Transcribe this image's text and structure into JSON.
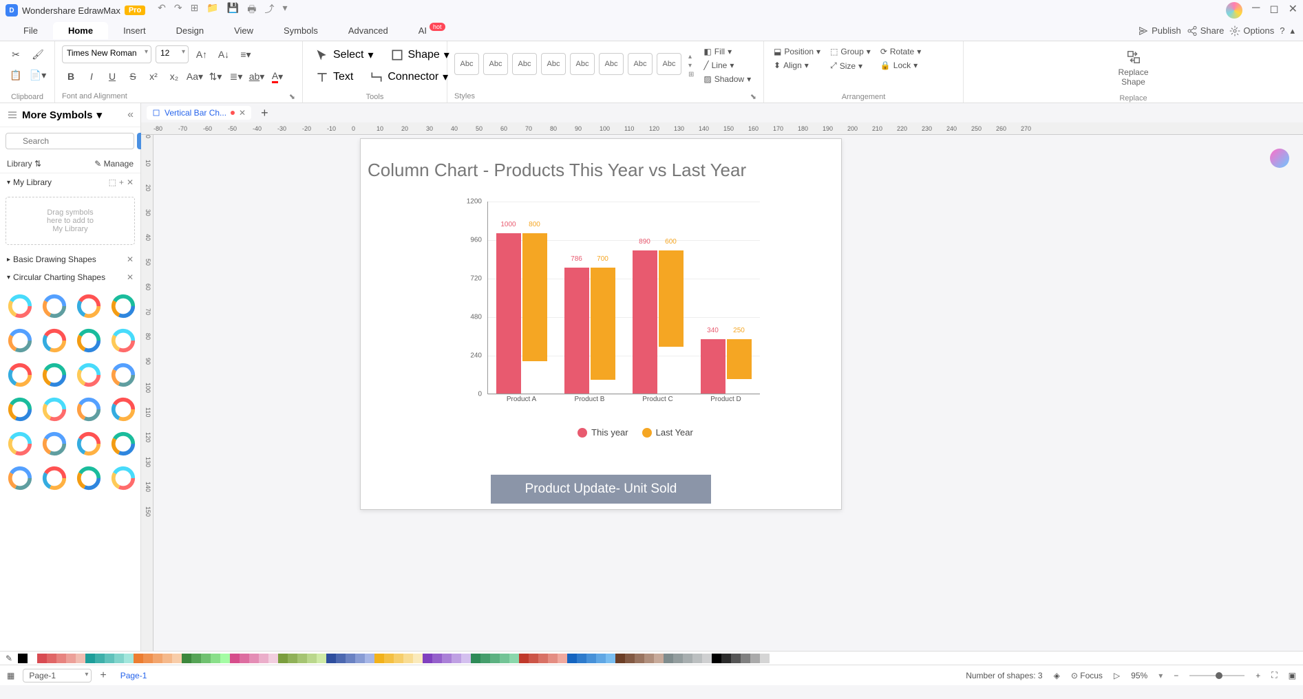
{
  "titlebar": {
    "app_name": "Wondershare EdrawMax",
    "pro": "Pro"
  },
  "menus": [
    "File",
    "Home",
    "Insert",
    "Design",
    "View",
    "Symbols",
    "Advanced",
    "AI"
  ],
  "menu_active": "Home",
  "menu_hot": "hot",
  "menu_right": {
    "publish": "Publish",
    "share": "Share",
    "options": "Options"
  },
  "ribbon": {
    "clipboard_label": "Clipboard",
    "font_label": "Font and Alignment",
    "tools_label": "Tools",
    "styles_label": "Styles",
    "arrangement_label": "Arrangement",
    "replace_label": "Replace",
    "font_family": "Times New Roman",
    "font_size": "12",
    "select": "Select",
    "shape": "Shape",
    "text": "Text",
    "connector": "Connector",
    "style_sample": "Abc",
    "fill": "Fill",
    "line": "Line",
    "shadow": "Shadow",
    "position": "Position",
    "group": "Group",
    "rotate": "Rotate",
    "align": "Align",
    "size": "Size",
    "lock": "Lock",
    "replace_shape": "Replace\nShape"
  },
  "left": {
    "more_symbols": "More Symbols",
    "search_placeholder": "Search",
    "search_btn": "Search",
    "library": "Library",
    "manage": "Manage",
    "section_my_library": "My Library",
    "drop_hint": "Drag symbols\nhere to add to\nMy Library",
    "section_basic": "Basic Drawing Shapes",
    "section_circular": "Circular Charting Shapes"
  },
  "doc_tab": "Vertical Bar Ch...",
  "ruler_h": [
    "-80",
    "-70",
    "-60",
    "-50",
    "-40",
    "-30",
    "-20",
    "-10",
    "0",
    "10",
    "20",
    "30",
    "40",
    "50",
    "60",
    "70",
    "80",
    "90",
    "100",
    "110",
    "120",
    "130",
    "140",
    "150",
    "160",
    "170",
    "180",
    "190",
    "200",
    "210",
    "220",
    "230",
    "240",
    "250",
    "260",
    "270"
  ],
  "ruler_v": [
    "0",
    "10",
    "20",
    "30",
    "40",
    "50",
    "60",
    "70",
    "80",
    "90",
    "100",
    "110",
    "120",
    "130",
    "140",
    "150"
  ],
  "chart_data": {
    "type": "bar",
    "title": "Column Chart - Products This Year vs Last Year",
    "categories": [
      "Product A",
      "Product B",
      "Product C",
      "Product D"
    ],
    "series": [
      {
        "name": "This year",
        "values": [
          1000,
          786,
          890,
          340
        ],
        "color": "#e85a6f"
      },
      {
        "name": "Last Year",
        "values": [
          800,
          700,
          600,
          250
        ],
        "color": "#f5a623"
      }
    ],
    "y_ticks": [
      0,
      240,
      480,
      720,
      960,
      1200
    ],
    "ylim": [
      0,
      1200
    ],
    "caption": "Product Update- Unit Sold"
  },
  "colors": [
    "#000000",
    "#ffffff",
    "#d84b52",
    "#e06666",
    "#e7837f",
    "#eca099",
    "#f1bdb2",
    "#1e9e9a",
    "#3fb0aa",
    "#60c2bb",
    "#81d4cb",
    "#a2e6dc",
    "#ec7d31",
    "#ef914f",
    "#f2a56d",
    "#f5b98b",
    "#f8cda9",
    "#3c873c",
    "#56a456",
    "#70c170",
    "#8adf8a",
    "#a4fca4",
    "#d64d8b",
    "#dd6da0",
    "#e48db5",
    "#ebaeca",
    "#f2cedf",
    "#7b9e3e",
    "#90b158",
    "#a5c472",
    "#bad78c",
    "#cfeaa6",
    "#2e4e9e",
    "#4c68b0",
    "#6a82c2",
    "#889cd4",
    "#a6b6e6",
    "#f2b21b",
    "#f4c043",
    "#f6ce6b",
    "#f8dc93",
    "#faeabb",
    "#8040bf",
    "#9560cb",
    "#aa80d7",
    "#bfa0e3",
    "#d4c0ef",
    "#2e8b57",
    "#459e6c",
    "#5cb181",
    "#73c496",
    "#8ad7ab",
    "#c0392b",
    "#cc5548",
    "#d87165",
    "#e48d82",
    "#f0a99f",
    "#1565c0",
    "#2e7bcc",
    "#4791d8",
    "#60a7e4",
    "#79bdf0",
    "#6b3e26",
    "#825943",
    "#997460",
    "#b08f7d",
    "#c7aa9a",
    "#7f8c8d",
    "#939d9e",
    "#a7aeaf",
    "#bbbfc0",
    "#cfd0d1",
    "#000000",
    "#2b2b2b",
    "#555555",
    "#808080",
    "#aaaaaa",
    "#d5d5d5"
  ],
  "status": {
    "page_select": "Page-1",
    "page_tab": "Page-1",
    "shape_count": "Number of shapes: 3",
    "focus": "Focus",
    "zoom": "95%"
  }
}
